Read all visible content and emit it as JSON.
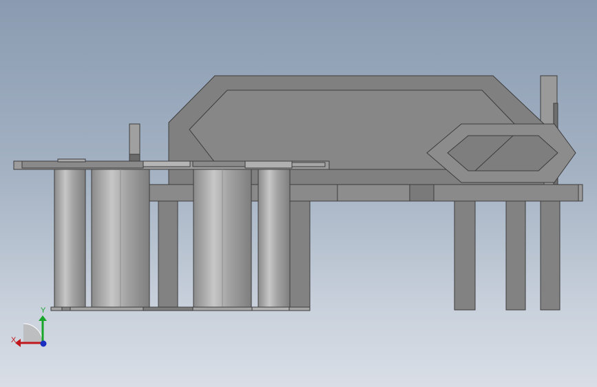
{
  "view": {
    "background_top": "#8a9bb1",
    "background_bottom": "#d9dee6",
    "part_fill": "#828282",
    "part_edge": "#3c3c3c",
    "roller_fill": "#a8a8a8"
  },
  "triad": {
    "x_label": "X",
    "y_label": "Y",
    "x_color": "#c0171c",
    "y_color": "#17a52a",
    "z_color": "#1a2fc0"
  }
}
